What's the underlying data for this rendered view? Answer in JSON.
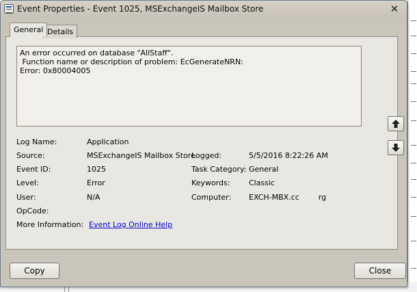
{
  "window": {
    "title": "Event Properties - Event 1025, MSExchangeIS Mailbox Store"
  },
  "tabs": [
    {
      "label": "General",
      "active": true
    },
    {
      "label": "Details",
      "active": false
    }
  ],
  "description": [
    "An error occurred on database \"AllStaff\".",
    " Function name or description of problem: EcGenerateNRN:",
    "Error: 0x80004005"
  ],
  "fields": {
    "log_name": {
      "label": "Log Name:",
      "value": "Application"
    },
    "source": {
      "label": "Source:",
      "value": "MSExchangeIS Mailbox Store"
    },
    "logged": {
      "label": "Logged:",
      "value": "5/5/2016 8:22:26 AM"
    },
    "event_id": {
      "label": "Event ID:",
      "value": "1025"
    },
    "task_category": {
      "label": "Task Category:",
      "value": "General"
    },
    "level": {
      "label": "Level:",
      "value": "Error"
    },
    "keywords": {
      "label": "Keywords:",
      "value": "Classic"
    },
    "user": {
      "label": "User:",
      "value": "N/A"
    },
    "computer": {
      "label": "Computer:",
      "value": "EXCH-MBX.cc        rg"
    },
    "opcode": {
      "label": "OpCode:",
      "value": ""
    },
    "more_info": {
      "label": "More Information:",
      "link": "Event Log Online Help"
    }
  },
  "buttons": {
    "copy": "Copy",
    "close": "Close"
  },
  "icons": {
    "up": "arrow-up-icon",
    "down": "arrow-down-icon",
    "close": "close-icon"
  },
  "colors": {
    "dialog_bg": "#c9c5bb",
    "panel_bg": "#e9e7e1",
    "link": "#0000cc"
  }
}
